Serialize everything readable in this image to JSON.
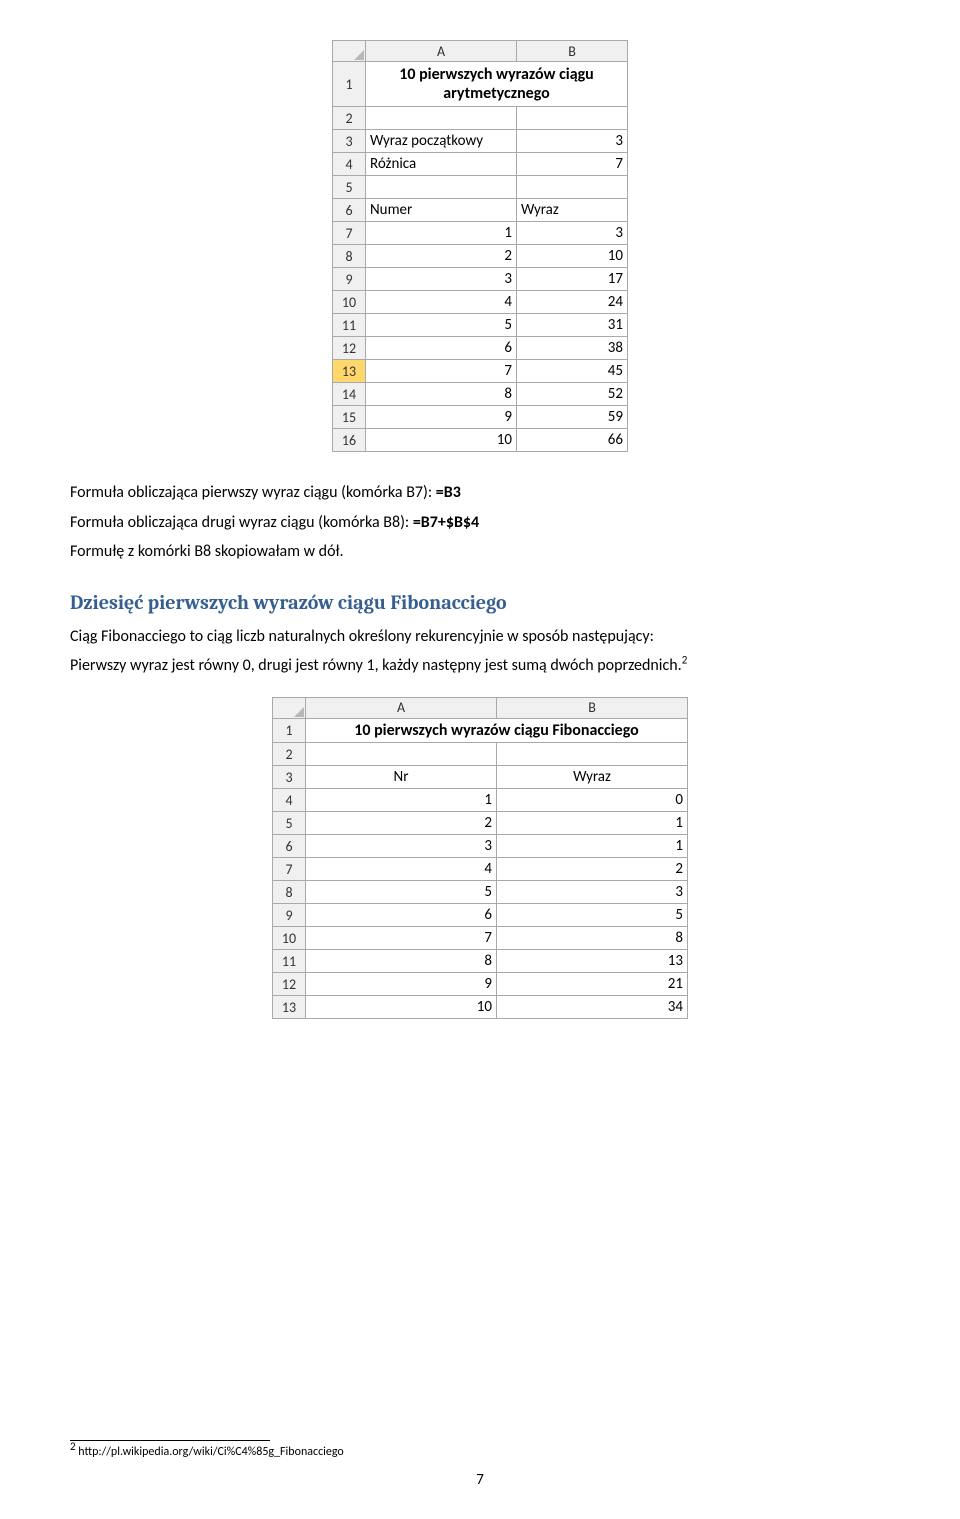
{
  "spreadsheet1": {
    "col_headers": [
      "A",
      "B"
    ],
    "merged_title": "10 pierwszych wyrazów ciągu arytmetycznego",
    "rows": [
      {
        "num": "1"
      },
      {
        "num": "2",
        "a": "",
        "b": ""
      },
      {
        "num": "3",
        "a": "Wyraz początkowy",
        "b": "3"
      },
      {
        "num": "4",
        "a": "Różnica",
        "b": "7"
      },
      {
        "num": "5",
        "a": "",
        "b": ""
      },
      {
        "num": "6",
        "a": "Numer",
        "b": "Wyraz",
        "b_align": "left"
      },
      {
        "num": "7",
        "a": "1",
        "a_align": "right",
        "b": "3"
      },
      {
        "num": "8",
        "a": "2",
        "a_align": "right",
        "b": "10"
      },
      {
        "num": "9",
        "a": "3",
        "a_align": "right",
        "b": "17"
      },
      {
        "num": "10",
        "a": "4",
        "a_align": "right",
        "b": "24"
      },
      {
        "num": "11",
        "a": "5",
        "a_align": "right",
        "b": "31"
      },
      {
        "num": "12",
        "a": "6",
        "a_align": "right",
        "b": "38"
      },
      {
        "num": "13",
        "a": "7",
        "a_align": "right",
        "b": "45",
        "highlight": true
      },
      {
        "num": "14",
        "a": "8",
        "a_align": "right",
        "b": "52"
      },
      {
        "num": "15",
        "a": "9",
        "a_align": "right",
        "b": "59"
      },
      {
        "num": "16",
        "a": "10",
        "a_align": "right",
        "b": "66"
      }
    ]
  },
  "para1_prefix": "Formuła obliczająca pierwszy wyraz ciągu (komórka B7):  ",
  "para1_formula": "=B3",
  "para2_prefix": "Formuła obliczająca drugi wyraz ciągu (komórka B8): ",
  "para2_formula": "=B7+$B$4",
  "para3": "Formułę z komórki B8 skopiowałam w dół.",
  "heading": "Dziesięć pierwszych wyrazów ciągu Fibonacciego",
  "para4": "Ciąg Fibonacciego to ciąg liczb naturalnych określony rekurencyjnie w sposób następujący:",
  "para5": "Pierwszy wyraz jest równy 0, drugi jest równy 1, każdy następny jest sumą dwóch poprzednich.",
  "footnote_mark": "2",
  "spreadsheet2": {
    "col_headers": [
      "A",
      "B"
    ],
    "merged_title": "10 pierwszych wyrazów ciągu Fibonacciego",
    "rows": [
      {
        "num": "1"
      },
      {
        "num": "2",
        "a": "",
        "b": ""
      },
      {
        "num": "3",
        "a": "Nr",
        "a_align": "center",
        "b": "Wyraz",
        "b_align": "center"
      },
      {
        "num": "4",
        "a": "1",
        "a_align": "right",
        "b": "0"
      },
      {
        "num": "5",
        "a": "2",
        "a_align": "right",
        "b": "1"
      },
      {
        "num": "6",
        "a": "3",
        "a_align": "right",
        "b": "1"
      },
      {
        "num": "7",
        "a": "4",
        "a_align": "right",
        "b": "2"
      },
      {
        "num": "8",
        "a": "5",
        "a_align": "right",
        "b": "3"
      },
      {
        "num": "9",
        "a": "6",
        "a_align": "right",
        "b": "5"
      },
      {
        "num": "10",
        "a": "7",
        "a_align": "right",
        "b": "8"
      },
      {
        "num": "11",
        "a": "8",
        "a_align": "right",
        "b": "13"
      },
      {
        "num": "12",
        "a": "9",
        "a_align": "right",
        "b": "21"
      },
      {
        "num": "13",
        "a": "10",
        "a_align": "right",
        "b": "34"
      }
    ]
  },
  "footnote_text": "http://pl.wikipedia.org/wiki/Ci%C4%85g_Fibonacciego",
  "page_number": "7"
}
